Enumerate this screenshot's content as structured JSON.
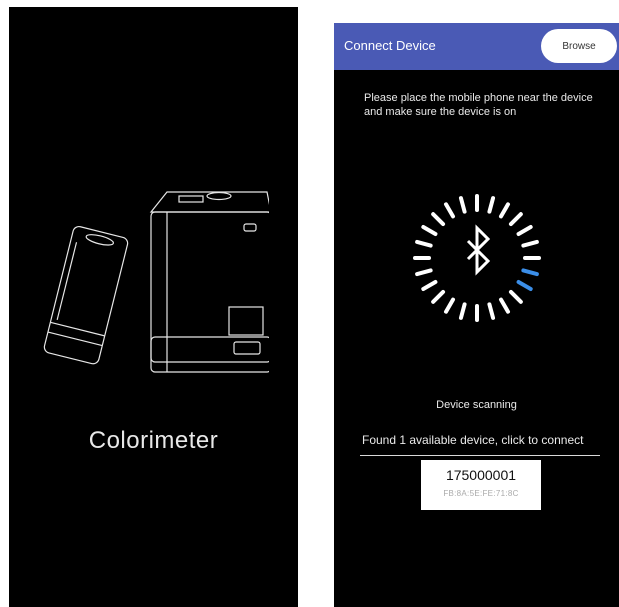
{
  "splash": {
    "app_title": "Colorimeter",
    "illustration_icon": "colorimeter-devices-icon"
  },
  "connect": {
    "header_title": "Connect Device",
    "browse_label": "Browse",
    "instructions": "Please place the mobile phone near the device and make sure the device is on",
    "spinner_icon": "bluetooth-icon",
    "scan_status": "Device scanning",
    "found_text": "Found 1 available device, click to connect",
    "devices": [
      {
        "name": "175000001",
        "mac": "FB:8A:5E:FE:71:8C"
      }
    ]
  },
  "colors": {
    "header_bg": "#4a5ab5",
    "background": "#000000",
    "spinner_active": "#3b8ee8"
  }
}
